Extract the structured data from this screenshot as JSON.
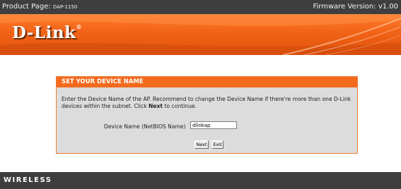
{
  "header": {
    "product_page_label": "Product Page:",
    "product_model": "DAP-1150",
    "firmware_label": "Firmware Version: v1.00"
  },
  "brand": {
    "logo_text": "D-Link",
    "registered_mark": "®"
  },
  "wizard": {
    "title": "SET YOUR DEVICE NAME",
    "description_pre": "Enter the Device Name of the AP. Recommend to change the Device Name if there're more than one D-Link devices within the subnet. Click ",
    "description_bold": "Next",
    "description_post": " to continue.",
    "field_label": "Device Name (NetBIOS Name)",
    "field_value": "dlinkap",
    "next_label": "Next",
    "exit_label": "Exit"
  },
  "footer": {
    "label": "WIRELESS"
  },
  "colors": {
    "brand_orange": "#f26a1d",
    "bar_dark": "#3e3e3e",
    "panel_gray": "#dcdcdc"
  }
}
